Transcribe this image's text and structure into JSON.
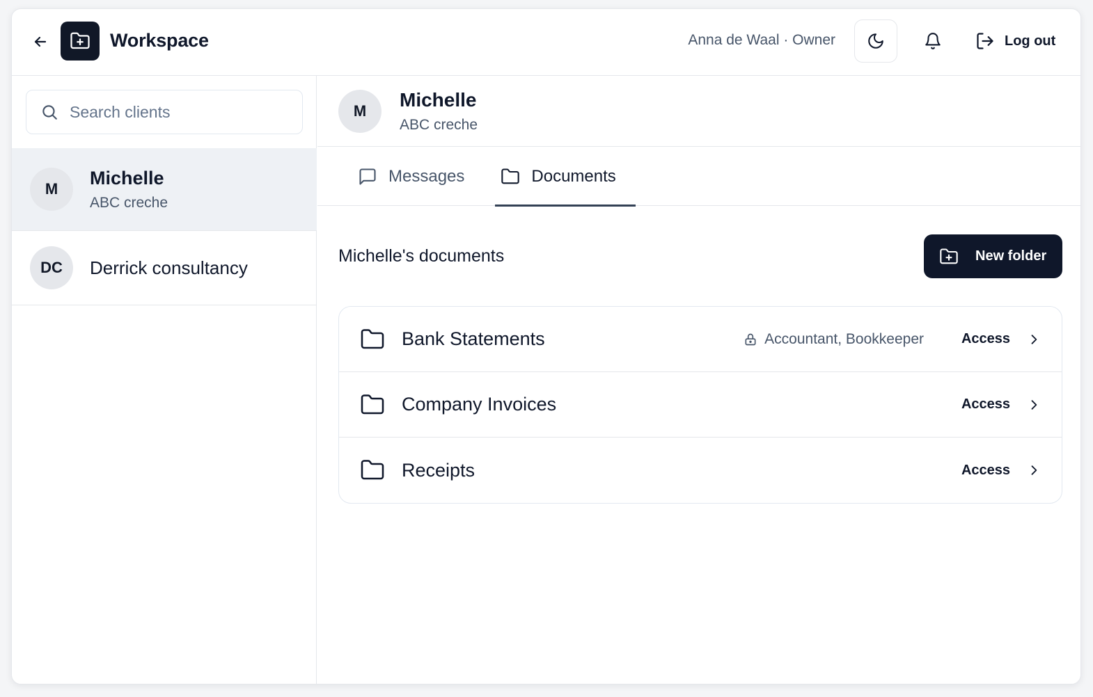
{
  "header": {
    "title": "Workspace",
    "user_label": "Anna de Waal · Owner",
    "logout_label": "Log out"
  },
  "sidebar": {
    "search": {
      "placeholder": "Search clients",
      "value": ""
    },
    "clients": [
      {
        "initials": "M",
        "name": "Michelle",
        "subtitle": "ABC creche",
        "active": true
      },
      {
        "initials": "DC",
        "name": "Derrick consultancy",
        "active": false
      }
    ]
  },
  "main": {
    "client": {
      "initials": "M",
      "name": "Michelle",
      "subtitle": "ABC creche"
    },
    "tabs": [
      {
        "label": "Messages",
        "icon": "message-square-icon",
        "active": false
      },
      {
        "label": "Documents",
        "icon": "folder-icon",
        "active": true
      }
    ],
    "docs_title": "Michelle's documents",
    "new_folder_label": "New folder",
    "folders": [
      {
        "name": "Bank Statements",
        "permissions": "Accountant, Bookkeeper",
        "action": "Access"
      },
      {
        "name": "Company Invoices",
        "action": "Access"
      },
      {
        "name": "Receipts",
        "action": "Access"
      }
    ]
  },
  "colors": {
    "primary": "#0f172a",
    "muted_text": "#475569",
    "border": "#e5e7eb",
    "active_row_bg": "#eef1f5",
    "avatar_bg": "#e5e7eb"
  }
}
